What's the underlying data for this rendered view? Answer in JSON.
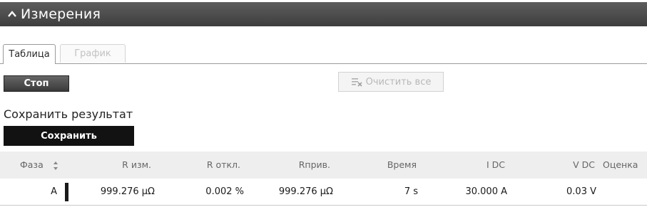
{
  "panel": {
    "title": "Измерения"
  },
  "tabs": [
    {
      "label": "Таблица",
      "active": true
    },
    {
      "label": "График",
      "active": false
    }
  ],
  "toolbar": {
    "stop_label": "Стоп",
    "clear_label": "Очистить все"
  },
  "save": {
    "section_label": "Сохранить результат",
    "button_label": "Сохранить"
  },
  "table": {
    "columns": [
      "Фаза",
      "R изм.",
      "R откл.",
      "Rприв.",
      "Время",
      "I DC",
      "V DC",
      "Оценка"
    ],
    "rows": [
      {
        "phase": "A",
        "r_meas": "999.276 µΩ",
        "r_dev": "0.002 %",
        "r_red": "999.276 µΩ",
        "time": "7 s",
        "i_dc": "30.000 A",
        "v_dc": "0.03 V",
        "grade": ""
      }
    ]
  },
  "colors": {
    "header_bg": "#4a4a4a",
    "save_bg": "#121212",
    "table_header_bg": "#eeeeee"
  }
}
